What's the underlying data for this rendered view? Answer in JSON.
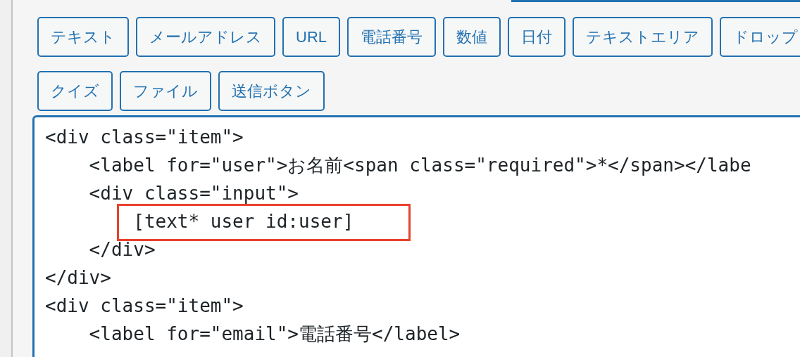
{
  "tag_buttons": [
    {
      "label": "テキスト"
    },
    {
      "label": "メールアドレス"
    },
    {
      "label": "URL"
    },
    {
      "label": "電話番号"
    },
    {
      "label": "数値"
    },
    {
      "label": "日付"
    },
    {
      "label": "テキストエリア"
    },
    {
      "label": "ドロップ"
    },
    {
      "label": "クイズ"
    },
    {
      "label": "ファイル"
    },
    {
      "label": "送信ボタン"
    }
  ],
  "editor": {
    "lines": [
      {
        "text": "<div class=\"item\">",
        "highlighted": false
      },
      {
        "text": "    <label for=\"user\">お名前<span class=\"required\">*</span></labe",
        "highlighted": false
      },
      {
        "text": "    <div class=\"input\">",
        "highlighted": false
      },
      {
        "text": "        [text* user id:user]",
        "highlighted": true
      },
      {
        "text": "    </div>",
        "highlighted": false
      },
      {
        "text": "</div>",
        "highlighted": false
      },
      {
        "text": "<div class=\"item\">",
        "highlighted": false
      },
      {
        "text": "    <label for=\"email\">電話番号</label>",
        "highlighted": false
      }
    ]
  }
}
